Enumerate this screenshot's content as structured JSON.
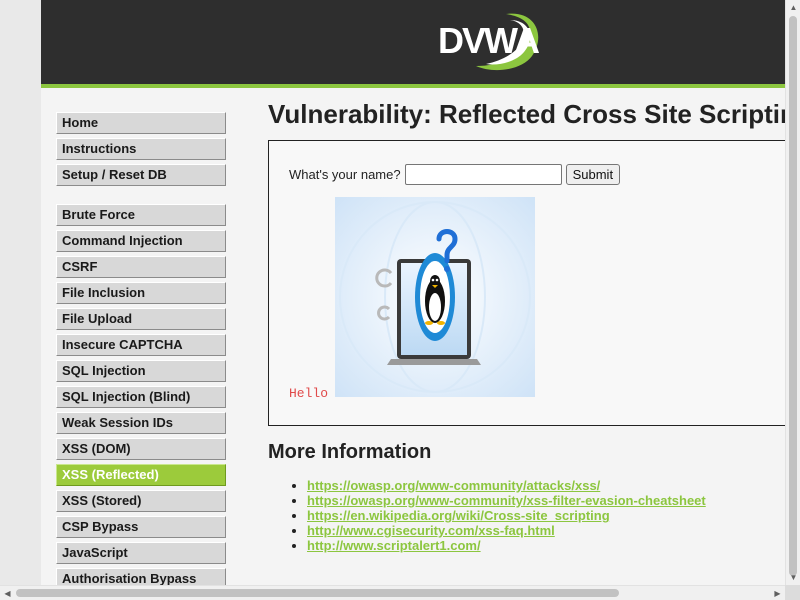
{
  "header": {
    "logo_text": "DVWA"
  },
  "nav": {
    "groups": [
      [
        {
          "label": "Home",
          "active": false
        },
        {
          "label": "Instructions",
          "active": false
        },
        {
          "label": "Setup / Reset DB",
          "active": false
        }
      ],
      [
        {
          "label": "Brute Force",
          "active": false
        },
        {
          "label": "Command Injection",
          "active": false
        },
        {
          "label": "CSRF",
          "active": false
        },
        {
          "label": "File Inclusion",
          "active": false
        },
        {
          "label": "File Upload",
          "active": false
        },
        {
          "label": "Insecure CAPTCHA",
          "active": false
        },
        {
          "label": "SQL Injection",
          "active": false
        },
        {
          "label": "SQL Injection (Blind)",
          "active": false
        },
        {
          "label": "Weak Session IDs",
          "active": false
        },
        {
          "label": "XSS (DOM)",
          "active": false
        },
        {
          "label": "XSS (Reflected)",
          "active": true
        },
        {
          "label": "XSS (Stored)",
          "active": false
        },
        {
          "label": "CSP Bypass",
          "active": false
        },
        {
          "label": "JavaScript",
          "active": false
        },
        {
          "label": "Authorisation Bypass",
          "active": false
        }
      ]
    ]
  },
  "main": {
    "title": "Vulnerability: Reflected Cross Site Scripting (XSS)",
    "form": {
      "label": "What's your name?",
      "input_value": "",
      "submit_label": "Submit"
    },
    "output_text": "Hello",
    "more_info_title": "More Information",
    "links": [
      "https://owasp.org/www-community/attacks/xss/",
      "https://owasp.org/www-community/xss-filter-evasion-cheatsheet",
      "https://en.wikipedia.org/wiki/Cross-site_scripting",
      "http://www.cgisecurity.com/xss-faq.html",
      "http://www.scriptalert1.com/"
    ]
  },
  "colors": {
    "header_bg": "#2e2e2e",
    "accent_green": "#8cc63f",
    "active_nav_bg": "#9ccb3b",
    "hello_red": "#e04a4a"
  },
  "icons": {
    "logo": "dvwa-swoosh-logo",
    "injected_image": "linux-tux-laptop-question-image",
    "scroll_up": "arrow-up-icon",
    "scroll_down": "arrow-down-icon",
    "scroll_left": "arrow-left-icon",
    "scroll_right": "arrow-right-icon"
  }
}
